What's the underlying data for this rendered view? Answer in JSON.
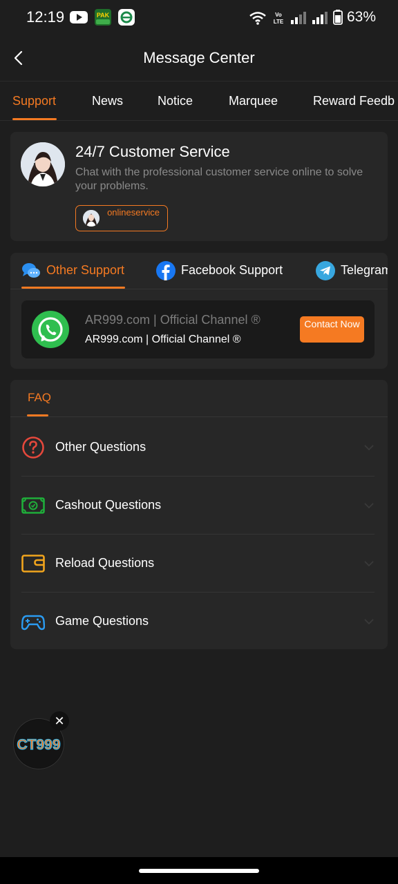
{
  "status_bar": {
    "time": "12:19",
    "battery_pct": "63%",
    "app_badge_label": "PAK"
  },
  "header": {
    "title": "Message Center"
  },
  "tabs": [
    {
      "label": "Support",
      "active": true
    },
    {
      "label": "News",
      "active": false
    },
    {
      "label": "Notice",
      "active": false
    },
    {
      "label": "Marquee",
      "active": false
    },
    {
      "label": "Reward Feedb",
      "active": false
    }
  ],
  "customer_service": {
    "title": "24/7 Customer Service",
    "description": "Chat with the professional customer service online to solve your problems.",
    "chip_label": "onlineservice"
  },
  "support_tabs": [
    {
      "label": "Other Support",
      "icon": "chat-bubbles-icon",
      "active": true
    },
    {
      "label": "Facebook Support",
      "icon": "facebook-icon",
      "active": false
    },
    {
      "label": "Telegram",
      "icon": "telegram-icon",
      "active": false
    }
  ],
  "channel": {
    "name": "AR999.com | Official Channel ®",
    "subtitle": "AR999.com | Official Channel ®",
    "button_label": "Contact Now",
    "icon": "whatsapp-icon"
  },
  "faq": {
    "tab_label": "FAQ",
    "items": [
      {
        "label": "Other Questions",
        "icon": "question-circle-icon"
      },
      {
        "label": "Cashout Questions",
        "icon": "cash-icon"
      },
      {
        "label": "Reload Questions",
        "icon": "wallet-icon"
      },
      {
        "label": "Game Questions",
        "icon": "gamepad-icon"
      }
    ]
  },
  "floating": {
    "logo_text": "CT999",
    "close_symbol": "✕"
  },
  "colors": {
    "accent": "#f57a22",
    "background": "#1e1e1e",
    "card": "#272727"
  }
}
